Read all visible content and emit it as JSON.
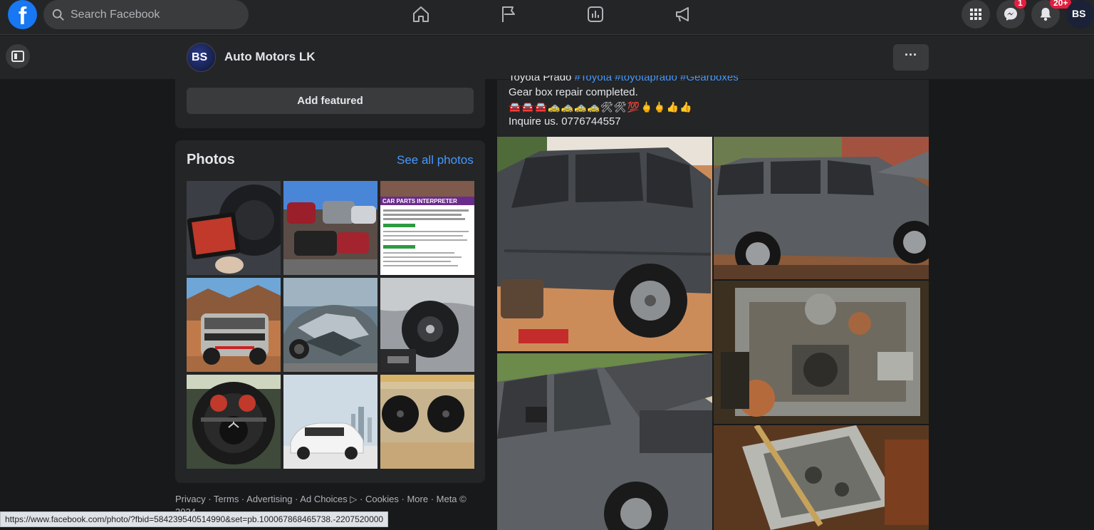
{
  "topbar": {
    "logo": "f",
    "search_placeholder": "Search Facebook",
    "messenger_badge": "1",
    "notifications_badge": "20+",
    "avatar_initials": "BS"
  },
  "page": {
    "name": "Auto Motors LK",
    "avatar_initials": "BS",
    "more_label": "···"
  },
  "featured": {
    "button_label": "Add featured"
  },
  "photos": {
    "title": "Photos",
    "see_all": "See all photos",
    "thumb3_heading": "CAR PARTS INTERPRETER"
  },
  "footer": {
    "links": "Privacy · Terms · Advertising · Ad Choices ▷ · Cookies · More · Meta © 2024"
  },
  "status_url": "https://www.facebook.com/photo/?fbid=584239540514990&set=pb.100067868465738.-2207520000",
  "post": {
    "line1_prefix": "Toyota Prado ",
    "line1_tags": "#Toyota #toyotaprado #Gearboxes",
    "line2": "Gear box repair completed.",
    "emojis": "🚘🚘🚘🚕🚕🚕🚕🛠🛠💯🖕🖕👍👍",
    "line4": "Inquire us. 0776744557"
  },
  "colors": {
    "background": "#18191a",
    "surface": "#242526",
    "button": "#3a3b3c",
    "link": "#4599ff",
    "brand": "#1877f2",
    "badge": "#e41e3f"
  }
}
